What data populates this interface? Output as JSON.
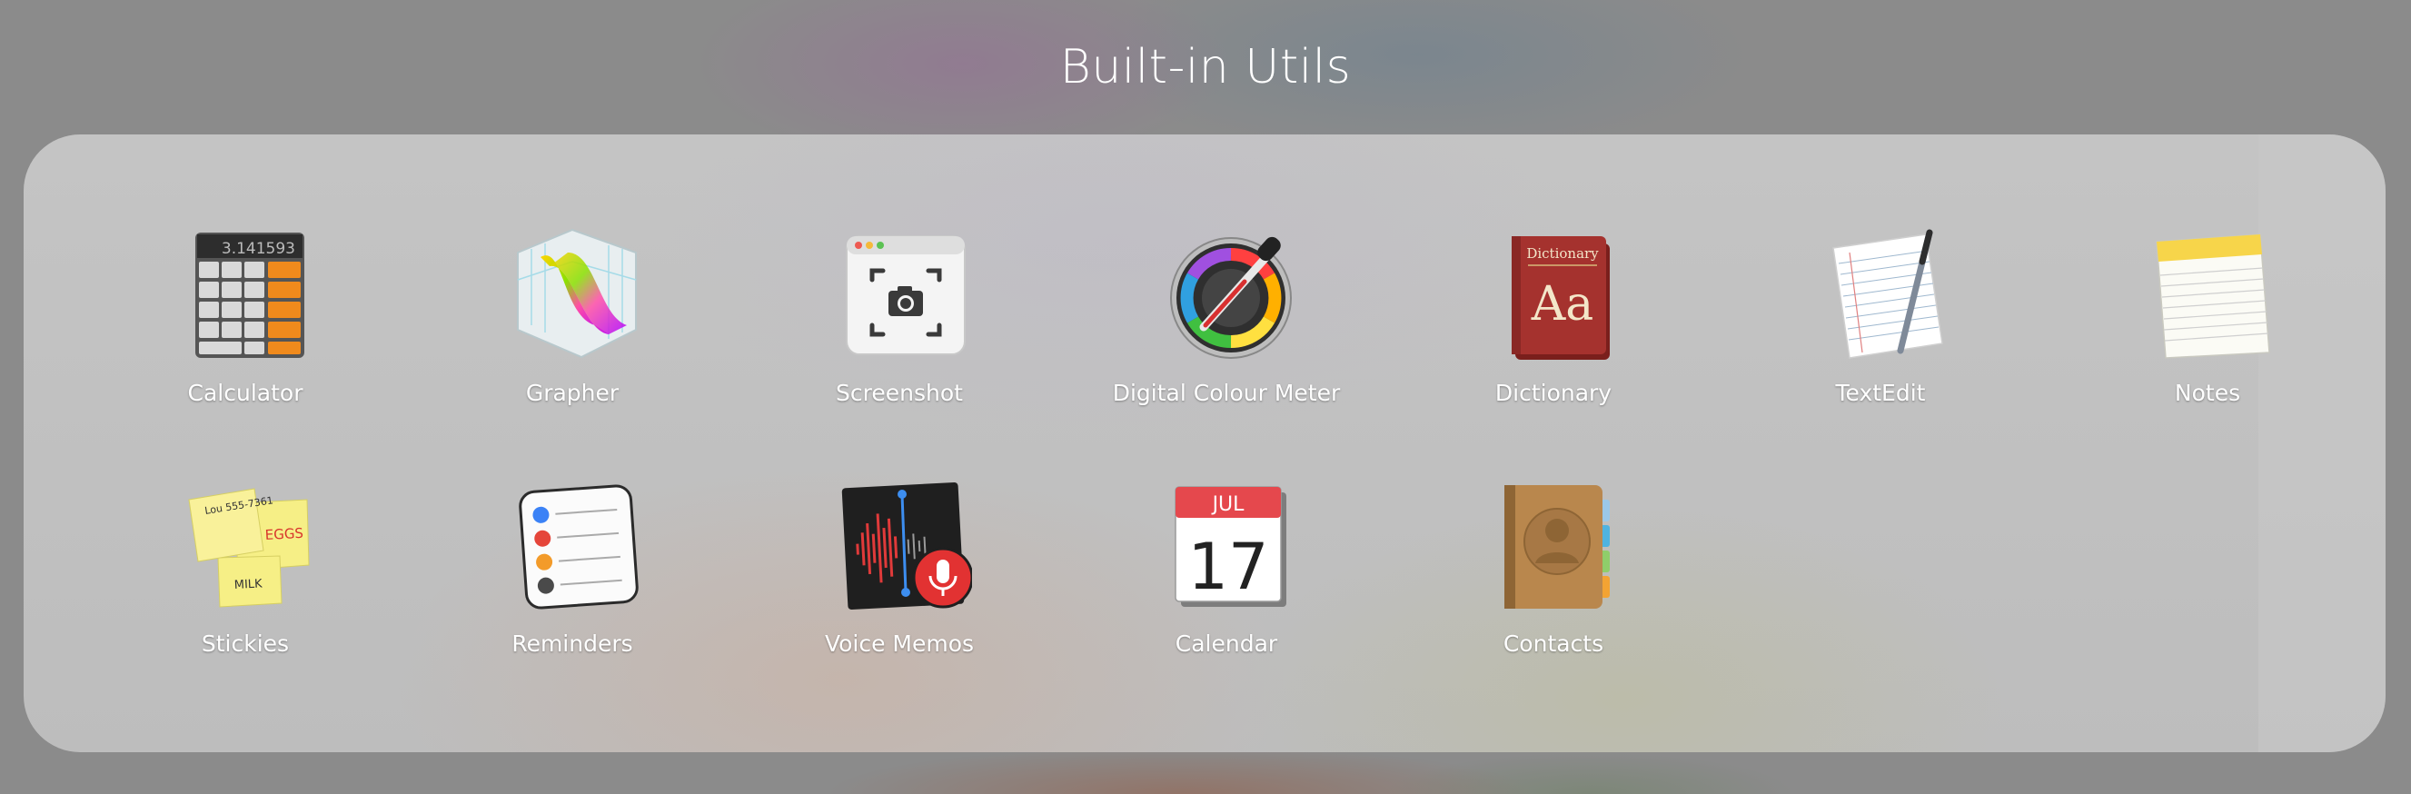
{
  "folder": {
    "title": "Built-in Utils"
  },
  "apps": [
    {
      "label": "Calculator",
      "icon": "calculator-icon"
    },
    {
      "label": "Grapher",
      "icon": "grapher-icon"
    },
    {
      "label": "Screenshot",
      "icon": "screenshot-icon"
    },
    {
      "label": "Digital Colour Meter",
      "icon": "colour-meter-icon"
    },
    {
      "label": "Dictionary",
      "icon": "dictionary-icon"
    },
    {
      "label": "TextEdit",
      "icon": "textedit-icon"
    },
    {
      "label": "Notes",
      "icon": "notes-icon"
    },
    {
      "label": "Stickies",
      "icon": "stickies-icon"
    },
    {
      "label": "Reminders",
      "icon": "reminders-icon"
    },
    {
      "label": "Voice Memos",
      "icon": "voice-memos-icon"
    },
    {
      "label": "Calendar",
      "icon": "calendar-icon"
    },
    {
      "label": "Contacts",
      "icon": "contacts-icon"
    }
  ],
  "icon_text": {
    "calculator_display": "3.141593",
    "dictionary_cover": "Dictionary",
    "dictionary_glyph": "Aa",
    "calendar_month": "JUL",
    "calendar_day": "17",
    "stickies_note1": "Lou 555-7361",
    "stickies_note2": "EGGS",
    "stickies_note3": "MILK"
  },
  "colors": {
    "calculator_orange": "#f08a1c",
    "dictionary_red": "#a5322e",
    "notes_yellow": "#f7d54a",
    "voice_memo_red": "#e23232",
    "calendar_red": "#e5484d",
    "contacts_brown": "#b9874d"
  }
}
